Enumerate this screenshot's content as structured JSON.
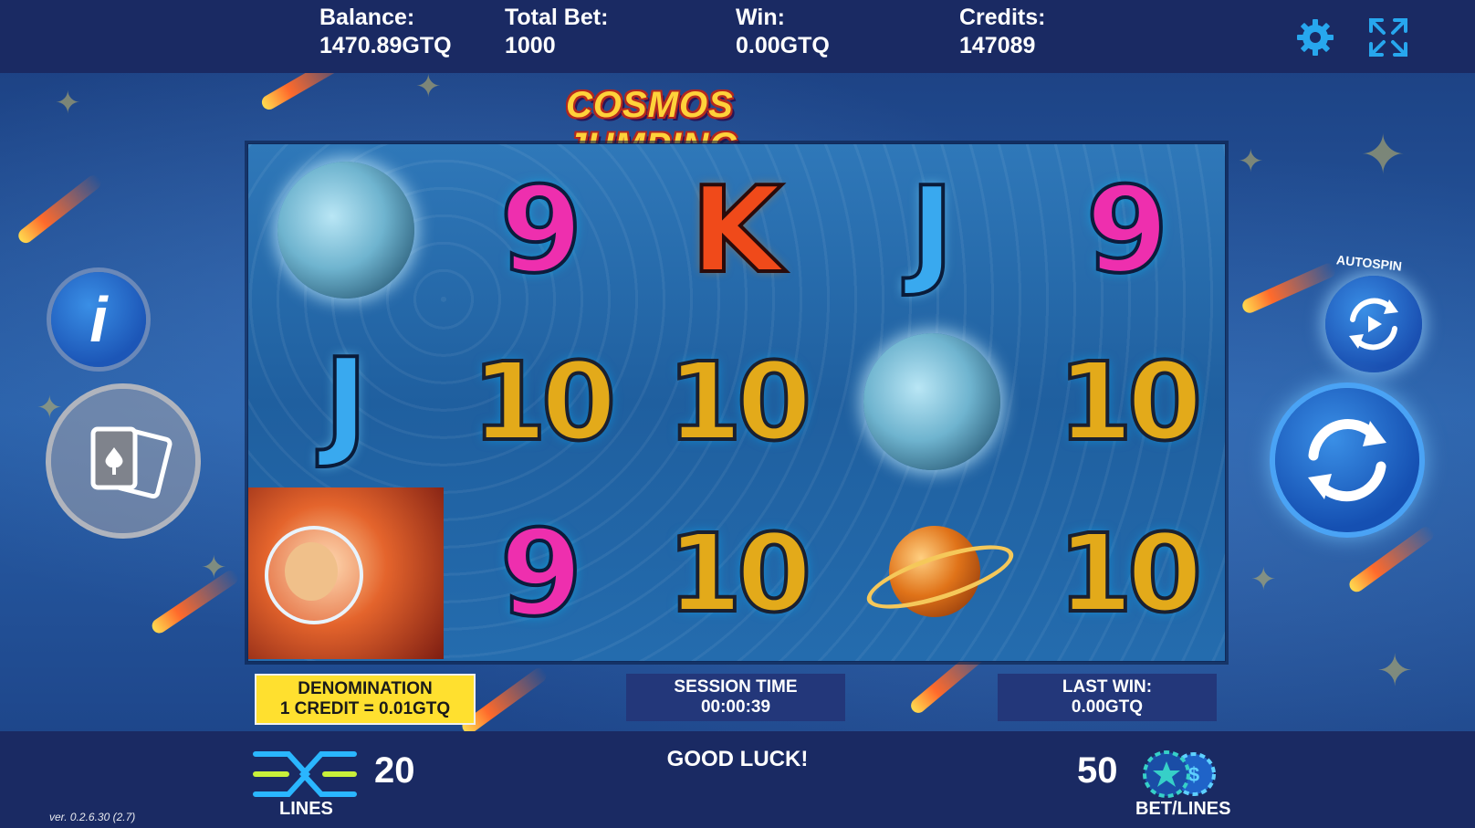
{
  "header": {
    "balance_label": "Balance:",
    "balance_value": "1470.89GTQ",
    "total_bet_label": "Total Bet:",
    "total_bet_value": "1000",
    "win_label": "Win:",
    "win_value": "0.00GTQ",
    "credits_label": "Credits:",
    "credits_value": "147089",
    "settings_icon": "gear-icon",
    "fullscreen_icon": "expand-icon"
  },
  "game": {
    "title": "COSMOS JUMPING"
  },
  "reels": {
    "rows": [
      [
        "asteroid",
        "9",
        "K",
        "J",
        "9"
      ],
      [
        "J",
        "10",
        "10",
        "asteroid",
        "10"
      ],
      [
        "astronaut",
        "9",
        "10",
        "planet",
        "10"
      ]
    ]
  },
  "info": {
    "denomination_label": "DENOMINATION",
    "denomination_value": "1 CREDIT = 0.01GTQ",
    "session_time_label": "SESSION TIME",
    "session_time_value": "00:00:39",
    "last_win_label": "LAST WIN:",
    "last_win_value": "0.00GTQ"
  },
  "footer": {
    "lines_value": "20",
    "lines_label": "LINES",
    "message": "GOOD LUCK!",
    "bet_lines_value": "50",
    "bet_lines_label": "BET/LINES",
    "version": "ver. 0.2.6.30 (2.7)"
  },
  "controls": {
    "info_icon": "info-icon",
    "paytable_icon": "cards-icon",
    "autospin_label": "AUTOSPIN",
    "autospin_icon": "autospin-icon",
    "spin_icon": "spin-icon"
  },
  "colors": {
    "bar_bg": "#1a2a63",
    "accent_blue": "#1c56b7",
    "denom_bg": "#ffe02f"
  }
}
